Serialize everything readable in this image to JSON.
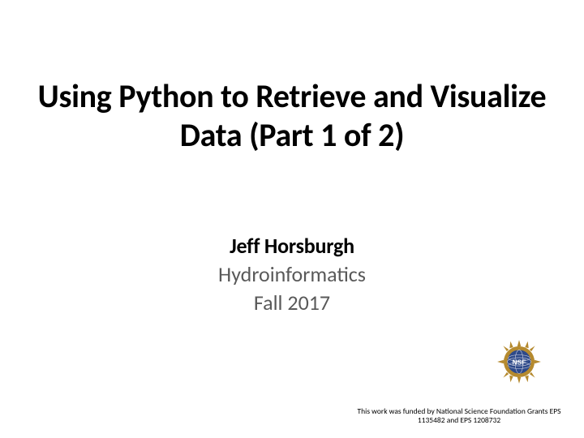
{
  "slide": {
    "title": "Using Python to Retrieve and Visualize Data (Part 1 of 2)",
    "author": "Jeff Horsburgh",
    "course": "Hydroinformatics",
    "term": "Fall 2017",
    "funding_note": "This work was funded by National Science Foundation Grants EPS 1135482 and EPS 1208732",
    "logo_name": "nsf-logo"
  }
}
